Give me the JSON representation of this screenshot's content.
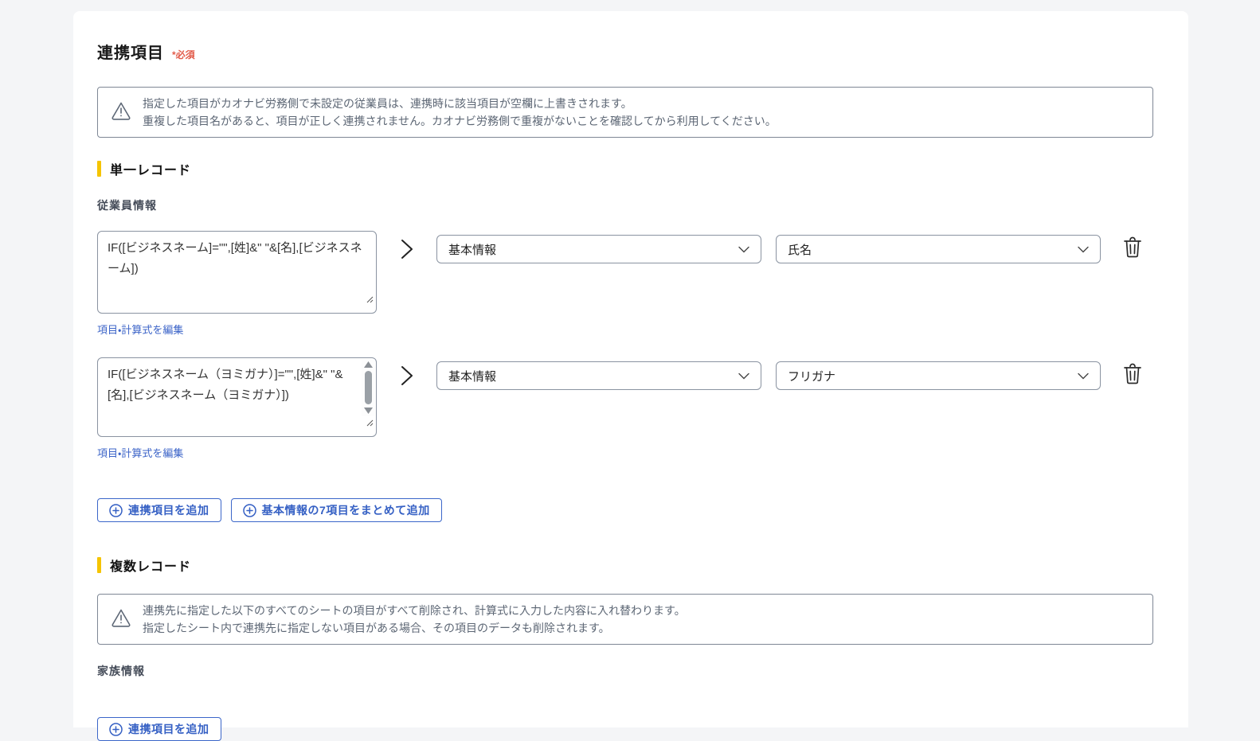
{
  "page": {
    "title": "連携項目",
    "required_badge": "*必須"
  },
  "warnings": {
    "top": {
      "line1": "指定した項目がカオナビ労務側で未設定の従業員は、連携時に該当項目が空欄に上書きされます。",
      "line2": "重複した項目名があると、項目が正しく連携されません。カオナビ労務側で重複がないことを確認してから利用してください。"
    },
    "multi": {
      "line1": "連携先に指定した以下のすべてのシートの項目がすべて削除され、計算式に入力した内容に入れ替わります。",
      "line2": "指定したシート内で連携先に指定しない項目がある場合、その項目のデータも削除されます。"
    }
  },
  "single_record": {
    "section_title": "単一レコード",
    "subsection": "従業員情報",
    "rows": [
      {
        "formula": "IF([ビジネスネーム]=\"\",[姓]&\" \"&[名],[ビジネスネーム])",
        "category": "基本情報",
        "field": "氏名",
        "edit_link": "項目・計算式を編集"
      },
      {
        "formula": "IF([ビジネスネーム（ヨミガナ）]=\"\",[姓]&\" \"&[名],[ビジネスネーム（ヨミガナ）])",
        "category": "基本情報",
        "field": "フリガナ",
        "edit_link": "項目・計算式を編集"
      }
    ],
    "add_item_button": "連携項目を追加",
    "add_bulk_button": "基本情報の7項目をまとめて追加"
  },
  "multi_record": {
    "section_title": "複数レコード",
    "subsection": "家族情報",
    "add_item_button": "連携項目を追加"
  },
  "colors": {
    "accent_yellow": "#f5c400",
    "link_blue": "#3c64c8",
    "button_blue": "#3560c4",
    "required_red": "#e25b4a",
    "warning_border": "#7e8795",
    "warning_text": "#5c6674"
  }
}
